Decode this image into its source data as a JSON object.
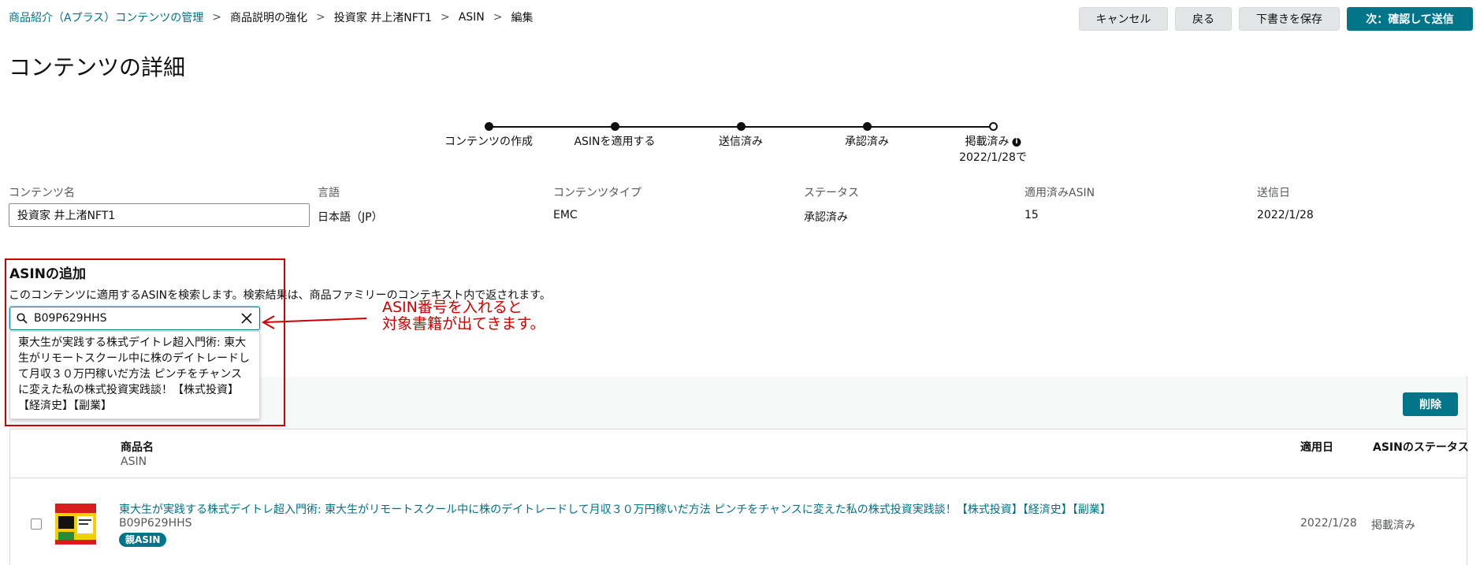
{
  "breadcrumb": {
    "items": [
      "商品紹介（Aプラス）コンテンツの管理",
      "商品説明の強化",
      "投資家 井上渚NFT1",
      "ASIN",
      "編集"
    ],
    "separator": ">"
  },
  "toolbar": {
    "cancel_label": "キャンセル",
    "back_label": "戻る",
    "save_draft_label": "下書きを保存",
    "next_label": "次：確認して送信"
  },
  "page_title": "コンテンツの詳細",
  "stepper": {
    "steps": [
      "コンテンツの作成",
      "ASINを適用する",
      "送信済み",
      "承認済み",
      "掲載済み"
    ],
    "published_date": "2022/1/28で",
    "info_icon": "info-icon"
  },
  "details": {
    "labels": {
      "name": "コンテンツ名",
      "language": "言語",
      "type": "コンテンツタイプ",
      "status": "ステータス",
      "applied_asin": "適用済みASIN",
      "sent_date": "送信日"
    },
    "values": {
      "name": "投資家 井上渚NFT1",
      "language": "日本語（JP）",
      "type": "EMC",
      "status": "承認済み",
      "applied_asin": "15",
      "sent_date": "2022/1/28"
    }
  },
  "asin_add": {
    "title": "ASINの追加",
    "description": "このコンテンツに適用するASINを検索します。検索結果は、商品ファミリーのコンテキスト内で返されます。",
    "search_value": "B09P629HHS",
    "suggestion": "東大生が実践する株式デイトレ超入門術: 東大生がリモートスクール中に株のデイトレードして月収３０万円稼いだ方法 ピンチをチャンスに変えた私の株式投資実践談！【株式投資】【経済史】【副業】"
  },
  "annotation": {
    "text": "ASIN番号を入れると\n対象書籍が出てきます。",
    "color": "#d00000"
  },
  "table": {
    "delete_label": "削除",
    "headers": {
      "product_name": "商品名",
      "asin": "ASIN",
      "applied_date": "適用日",
      "asin_status": "ASINのステータス"
    },
    "rows": [
      {
        "title": "東大生が実践する株式デイトレ超入門術: 東大生がリモートスクール中に株のデイトレードして月収３０万円稼いだ方法 ピンチをチャンスに変えた私の株式投資実践談！【株式投資】【経済史】【副業】",
        "asin": "B09P629HHS",
        "badge": "親ASIN",
        "applied_date": "2022/1/28",
        "status": "掲載済み"
      }
    ]
  },
  "colors": {
    "accent": "#00758a",
    "link": "#007185",
    "annotation": "#d00000"
  }
}
